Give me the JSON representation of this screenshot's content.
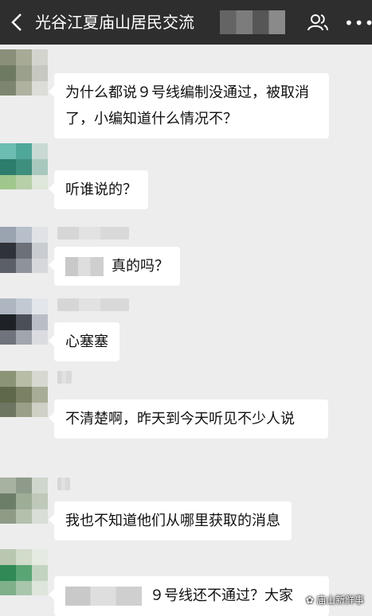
{
  "header": {
    "title": "光谷江夏庙山居民交流",
    "icons": [
      "back-icon",
      "group-members-icon",
      "more-icon"
    ]
  },
  "messages": [
    {
      "text": "为什么都说９号线编制没通过，被取消了，小编知道什么情况不？"
    },
    {
      "text": "听谁说的？"
    },
    {
      "text": "真的吗？"
    },
    {
      "text": "心塞塞"
    },
    {
      "text": "不清楚啊，昨天到今天听见不少人说"
    },
    {
      "text": "我也不知道他们从哪里获取的消息"
    },
    {
      "text": "９号线还不通过？大家"
    }
  ],
  "watermark": {
    "text": "庙山新鲜事",
    "icon": "wechat-logo-icon"
  }
}
